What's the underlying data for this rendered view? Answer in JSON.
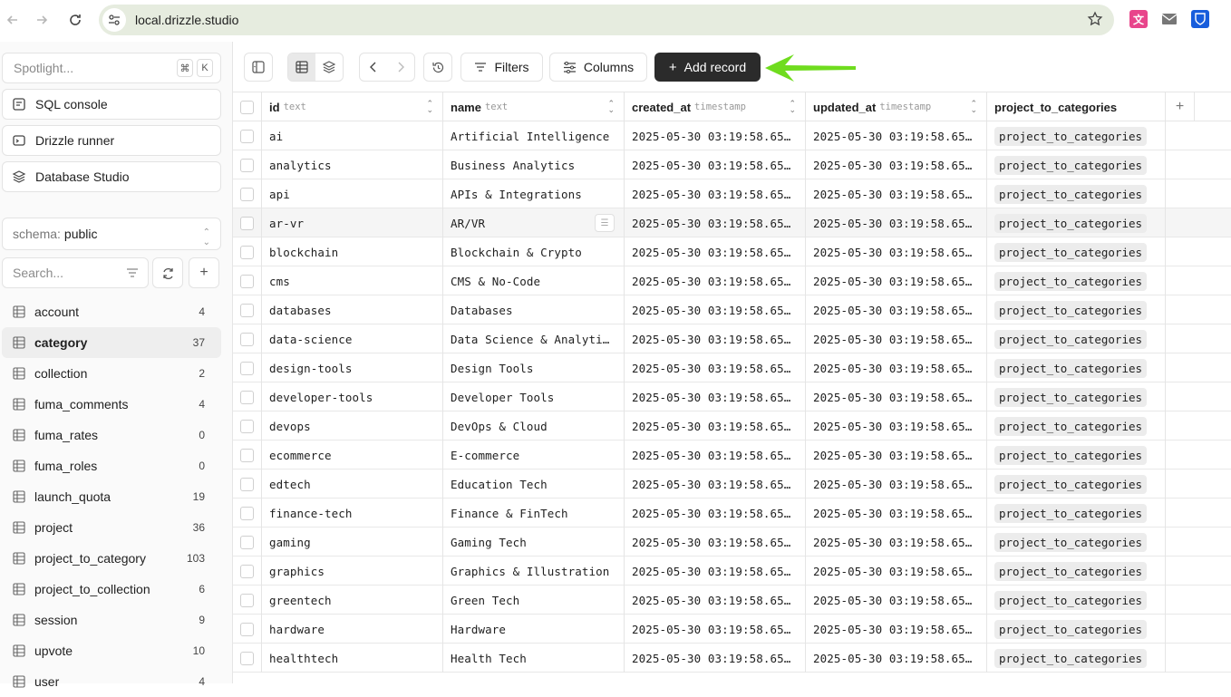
{
  "browser": {
    "url": "local.drizzle.studio",
    "colors": {
      "omnibox": "#e6ecdf"
    }
  },
  "sidebar": {
    "spotlight_placeholder": "Spotlight...",
    "spotlight_keys": [
      "⌘",
      "K"
    ],
    "nav": [
      {
        "label": "SQL console",
        "icon": "sql-console-icon"
      },
      {
        "label": "Drizzle runner",
        "icon": "runner-icon"
      },
      {
        "label": "Database Studio",
        "icon": "layers-icon"
      }
    ],
    "schema_label": "schema:",
    "schema_value": "public",
    "search_placeholder": "Search...",
    "tables": [
      {
        "name": "account",
        "count": "4"
      },
      {
        "name": "category",
        "count": "37",
        "active": true
      },
      {
        "name": "collection",
        "count": "2"
      },
      {
        "name": "fuma_comments",
        "count": "4"
      },
      {
        "name": "fuma_rates",
        "count": "0"
      },
      {
        "name": "fuma_roles",
        "count": "0"
      },
      {
        "name": "launch_quota",
        "count": "19"
      },
      {
        "name": "project",
        "count": "36"
      },
      {
        "name": "project_to_category",
        "count": "103"
      },
      {
        "name": "project_to_collection",
        "count": "6"
      },
      {
        "name": "session",
        "count": "9"
      },
      {
        "name": "upvote",
        "count": "10"
      },
      {
        "name": "user",
        "count": "4"
      }
    ]
  },
  "toolbar": {
    "filters_label": "Filters",
    "columns_label": "Columns",
    "add_record_label": "Add record",
    "accent_color": "#2b2b2b",
    "annotation_arrow_color": "#6fdc1e"
  },
  "grid": {
    "columns": [
      {
        "name": "id",
        "type": "text"
      },
      {
        "name": "name",
        "type": "text"
      },
      {
        "name": "created_at",
        "type": "timestamp"
      },
      {
        "name": "updated_at",
        "type": "timestamp"
      },
      {
        "name": "project_to_categories",
        "type": ""
      }
    ],
    "rows": [
      {
        "id": "ai",
        "name": "Artificial Intelligence",
        "created_at": "2025-05-30 03:19:58.65…",
        "updated_at": "2025-05-30 03:19:58.65…",
        "rel": "project_to_categories"
      },
      {
        "id": "analytics",
        "name": "Business Analytics",
        "created_at": "2025-05-30 03:19:58.65…",
        "updated_at": "2025-05-30 03:19:58.65…",
        "rel": "project_to_categories"
      },
      {
        "id": "api",
        "name": "APIs & Integrations",
        "created_at": "2025-05-30 03:19:58.65…",
        "updated_at": "2025-05-30 03:19:58.65…",
        "rel": "project_to_categories"
      },
      {
        "id": "ar-vr",
        "name": "AR/VR",
        "created_at": "2025-05-30 03:19:58.65…",
        "updated_at": "2025-05-30 03:19:58.65…",
        "rel": "project_to_categories",
        "hover": true
      },
      {
        "id": "blockchain",
        "name": "Blockchain & Crypto",
        "created_at": "2025-05-30 03:19:58.65…",
        "updated_at": "2025-05-30 03:19:58.65…",
        "rel": "project_to_categories"
      },
      {
        "id": "cms",
        "name": "CMS & No-Code",
        "created_at": "2025-05-30 03:19:58.65…",
        "updated_at": "2025-05-30 03:19:58.65…",
        "rel": "project_to_categories"
      },
      {
        "id": "databases",
        "name": "Databases",
        "created_at": "2025-05-30 03:19:58.65…",
        "updated_at": "2025-05-30 03:19:58.65…",
        "rel": "project_to_categories"
      },
      {
        "id": "data-science",
        "name": "Data Science & Analyti…",
        "created_at": "2025-05-30 03:19:58.65…",
        "updated_at": "2025-05-30 03:19:58.65…",
        "rel": "project_to_categories"
      },
      {
        "id": "design-tools",
        "name": "Design Tools",
        "created_at": "2025-05-30 03:19:58.65…",
        "updated_at": "2025-05-30 03:19:58.65…",
        "rel": "project_to_categories"
      },
      {
        "id": "developer-tools",
        "name": "Developer Tools",
        "created_at": "2025-05-30 03:19:58.65…",
        "updated_at": "2025-05-30 03:19:58.65…",
        "rel": "project_to_categories"
      },
      {
        "id": "devops",
        "name": "DevOps & Cloud",
        "created_at": "2025-05-30 03:19:58.65…",
        "updated_at": "2025-05-30 03:19:58.65…",
        "rel": "project_to_categories"
      },
      {
        "id": "ecommerce",
        "name": "E-commerce",
        "created_at": "2025-05-30 03:19:58.65…",
        "updated_at": "2025-05-30 03:19:58.65…",
        "rel": "project_to_categories"
      },
      {
        "id": "edtech",
        "name": "Education Tech",
        "created_at": "2025-05-30 03:19:58.65…",
        "updated_at": "2025-05-30 03:19:58.65…",
        "rel": "project_to_categories"
      },
      {
        "id": "finance-tech",
        "name": "Finance & FinTech",
        "created_at": "2025-05-30 03:19:58.65…",
        "updated_at": "2025-05-30 03:19:58.65…",
        "rel": "project_to_categories"
      },
      {
        "id": "gaming",
        "name": "Gaming Tech",
        "created_at": "2025-05-30 03:19:58.65…",
        "updated_at": "2025-05-30 03:19:58.65…",
        "rel": "project_to_categories"
      },
      {
        "id": "graphics",
        "name": "Graphics & Illustration",
        "created_at": "2025-05-30 03:19:58.65…",
        "updated_at": "2025-05-30 03:19:58.65…",
        "rel": "project_to_categories"
      },
      {
        "id": "greentech",
        "name": "Green Tech",
        "created_at": "2025-05-30 03:19:58.65…",
        "updated_at": "2025-05-30 03:19:58.65…",
        "rel": "project_to_categories"
      },
      {
        "id": "hardware",
        "name": "Hardware",
        "created_at": "2025-05-30 03:19:58.65…",
        "updated_at": "2025-05-30 03:19:58.65…",
        "rel": "project_to_categories"
      },
      {
        "id": "healthtech",
        "name": "Health Tech",
        "created_at": "2025-05-30 03:19:58.65…",
        "updated_at": "2025-05-30 03:19:58.65…",
        "rel": "project_to_categories"
      }
    ]
  }
}
